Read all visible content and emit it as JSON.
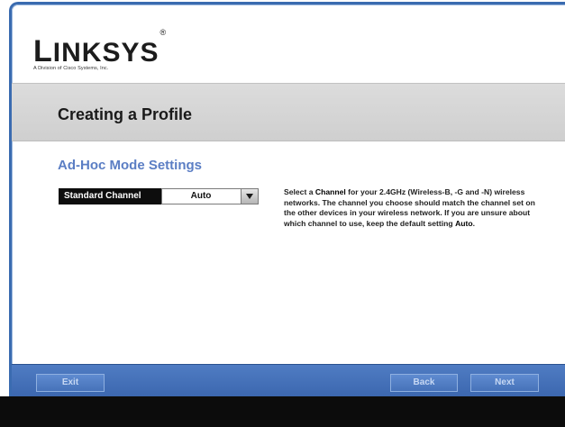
{
  "brand": {
    "logo_first": "L",
    "logo_rest": "INKSYS",
    "trademark": "®",
    "tagline": "A Division of Cisco Systems, Inc."
  },
  "page": {
    "title": "Creating a Profile",
    "section_title": "Ad-Hoc Mode Settings"
  },
  "channel_field": {
    "label": "Standard Channel",
    "selected_value": "Auto"
  },
  "help": {
    "t1": "Select a ",
    "t2": "Channel",
    "t3": " for your 2.4GHz (Wireless-B, -G and -N) wireless networks. The channel you choose should match the channel set on the other devices in your wireless network. If you are unsure about which channel to use, keep the default setting ",
    "t4": "Auto",
    "t5": "."
  },
  "buttons": {
    "exit": "Exit",
    "back": "Back",
    "next": "Next"
  },
  "colors": {
    "accent_blue": "#3a65ad",
    "section_title": "#5b7ec4",
    "label_bg": "#0d0d0d"
  },
  "icons": {
    "dropdown": "chevron-down-icon"
  }
}
